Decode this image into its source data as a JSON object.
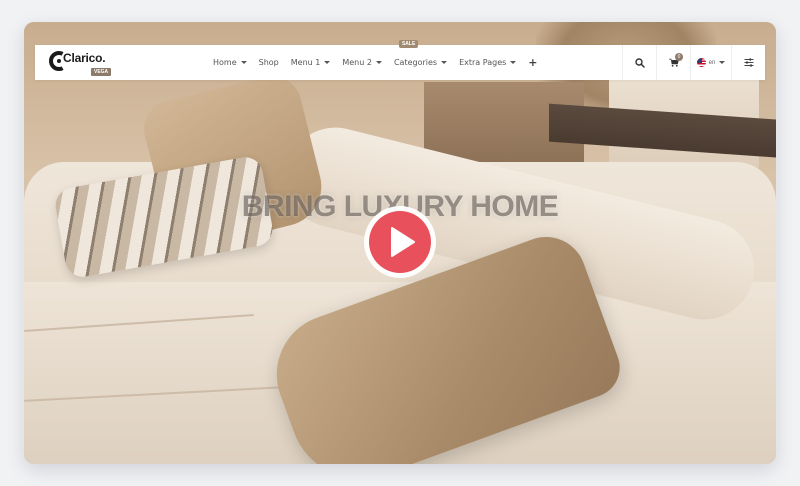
{
  "logo": {
    "name": "Clarico.",
    "tag": "VEGA",
    "tm": "™"
  },
  "nav": {
    "items": [
      {
        "label": "Home",
        "dropdown": true
      },
      {
        "label": "Shop",
        "dropdown": false
      },
      {
        "label": "Menu 1",
        "dropdown": true
      },
      {
        "label": "Menu 2",
        "dropdown": true
      },
      {
        "label": "Categories",
        "dropdown": true,
        "badge": "SALE"
      },
      {
        "label": "Extra Pages",
        "dropdown": true
      }
    ],
    "plus": "+"
  },
  "tools": {
    "search_icon": "search-icon",
    "cart_icon": "cart-icon",
    "cart_count": "0",
    "language": "en",
    "settings_icon": "sliders-icon"
  },
  "hero": {
    "title": "BRING LUXURY HOME",
    "play_icon": "play-icon"
  },
  "colors": {
    "accent": "#e8505b",
    "badge": "#a08a72",
    "header_bg": "#ffffff"
  }
}
